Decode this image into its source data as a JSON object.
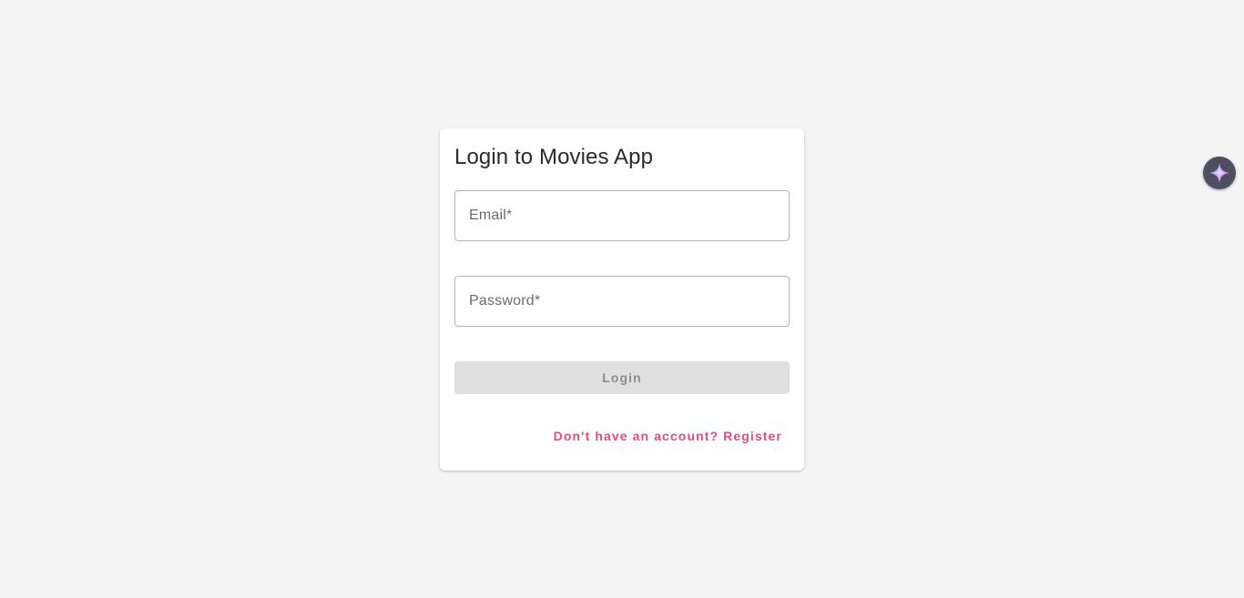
{
  "login_card": {
    "title": "Login to Movies App",
    "email_field": {
      "label": "Email*",
      "value": ""
    },
    "password_field": {
      "label": "Password*",
      "value": ""
    },
    "login_button": {
      "label": "Login",
      "state": "disabled"
    },
    "register_link": {
      "label": "Don't have an account? Register"
    }
  },
  "assistant_button": {
    "icon": "sparkle-icon"
  },
  "colors": {
    "page_background": "#f4f4f4",
    "card_background": "#ffffff",
    "link_accent": "#e8497c",
    "button_disabled_background": "#e0e0e0",
    "button_disabled_text": "#8c8c8c",
    "assistant_background": "#4e4e63"
  }
}
